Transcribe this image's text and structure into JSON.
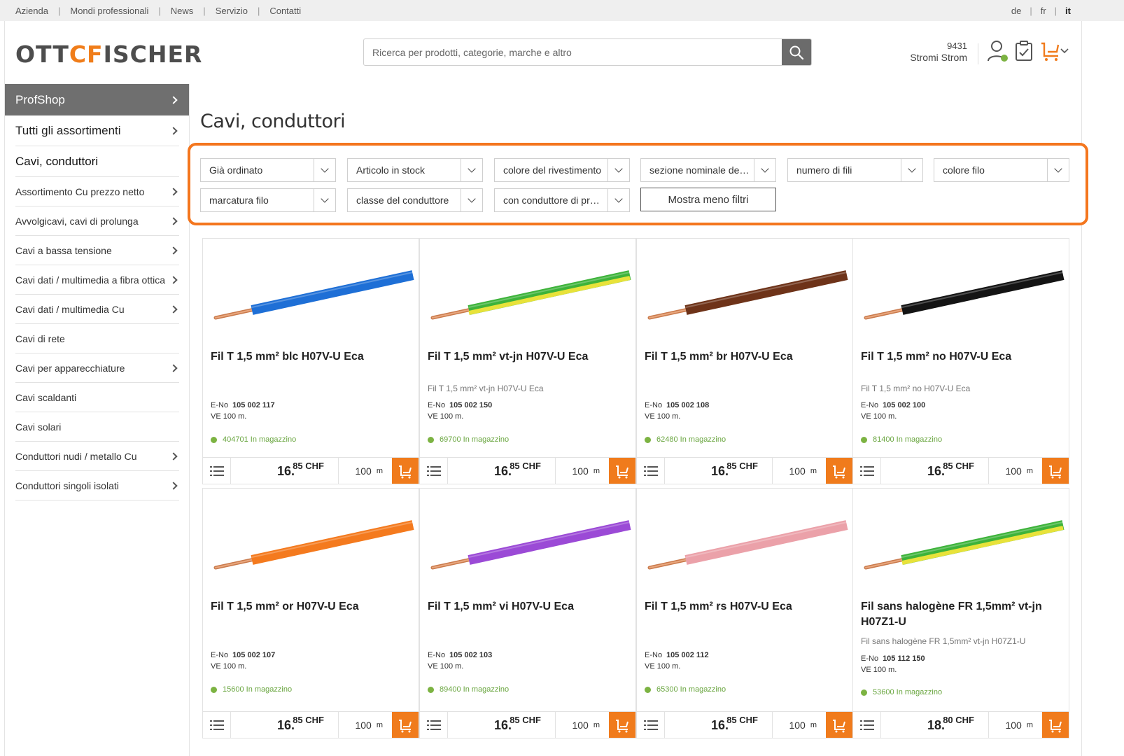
{
  "topnav": {
    "items": [
      "Azienda",
      "Mondi professionali",
      "News",
      "Servizio",
      "Contatti"
    ]
  },
  "languages": {
    "items": [
      "de",
      "fr",
      "it"
    ],
    "active": "it"
  },
  "header": {
    "logo_left": "OTT",
    "logo_mark": "CF",
    "logo_right": "ISCHER",
    "search_placeholder": "Ricerca per prodotti, categorie, marche e altro",
    "account_number": "9431",
    "account_name": "Stromi Strom",
    "icons": [
      "user-icon",
      "order-list-icon",
      "cart-icon",
      "chevron-down-icon"
    ]
  },
  "sidebar": {
    "top": "ProfShop",
    "main": [
      "Tutti gli assortimenti",
      "Cavi, conduttori"
    ],
    "sub": [
      {
        "label": "Assortimento Cu prezzo netto",
        "chevron": true
      },
      {
        "label": "Avvolgicavi, cavi di prolunga",
        "chevron": true
      },
      {
        "label": "Cavi a bassa tensione",
        "chevron": true
      },
      {
        "label": "Cavi dati / multimedia a fibra ottica",
        "chevron": true
      },
      {
        "label": "Cavi dati / multimedia Cu",
        "chevron": true
      },
      {
        "label": "Cavi di rete",
        "chevron": false
      },
      {
        "label": "Cavi per apparecchiature",
        "chevron": true
      },
      {
        "label": "Cavi scaldanti",
        "chevron": false
      },
      {
        "label": "Cavi solari",
        "chevron": false
      },
      {
        "label": "Conduttori nudi / metallo Cu",
        "chevron": true
      },
      {
        "label": "Conduttori singoli isolati",
        "chevron": true
      }
    ]
  },
  "page": {
    "title": "Cavi, conduttori"
  },
  "filters": {
    "selects": [
      "Già ordinato",
      "Articolo in stock",
      "colore del rivestimento",
      "sezione nominale del c...",
      "numero di fili",
      "colore filo",
      "marcatura filo",
      "classe del conduttore",
      "con conduttore di prot..."
    ],
    "toggle_label": "Mostra meno filtri"
  },
  "products": [
    {
      "name": "Fil T 1,5 mm² blc H07V-U Eca",
      "subtitle": "",
      "eno_label": "E-No",
      "eno": "105 002 117",
      "ve": "VE 100 m.",
      "stock": "404701 In magazzino",
      "price_int": "16.",
      "price_dec": "85 CHF",
      "qty": "100",
      "unit": "m",
      "color": "#1e6fd6",
      "color2": ""
    },
    {
      "name": "Fil T 1,5 mm² vt-jn H07V-U Eca",
      "subtitle": "Fil T 1,5 mm² vt-jn H07V-U Eca",
      "eno_label": "E-No",
      "eno": "105 002 150",
      "ve": "VE 100 m.",
      "stock": "69700 In magazzino",
      "price_int": "16.",
      "price_dec": "85 CHF",
      "qty": "100",
      "unit": "m",
      "color": "#3db33a",
      "color2": "#e8e23a"
    },
    {
      "name": "Fil T 1,5 mm² br H07V-U Eca",
      "subtitle": "",
      "eno_label": "E-No",
      "eno": "105 002 108",
      "ve": "VE 100 m.",
      "stock": "62480 In magazzino",
      "price_int": "16.",
      "price_dec": "85 CHF",
      "qty": "100",
      "unit": "m",
      "color": "#6e3319",
      "color2": ""
    },
    {
      "name": "Fil T 1,5 mm² no H07V-U Eca",
      "subtitle": "Fil T 1,5 mm² no H07V-U Eca",
      "eno_label": "E-No",
      "eno": "105 002 100",
      "ve": "VE 100 m.",
      "stock": "81400 In magazzino",
      "price_int": "16.",
      "price_dec": "85 CHF",
      "qty": "100",
      "unit": "m",
      "color": "#141414",
      "color2": ""
    },
    {
      "name": "Fil T 1,5 mm² or H07V-U Eca",
      "subtitle": "",
      "eno_label": "E-No",
      "eno": "105 002 107",
      "ve": "VE 100 m.",
      "stock": "15600 In magazzino",
      "price_int": "16.",
      "price_dec": "85 CHF",
      "qty": "100",
      "unit": "m",
      "color": "#f47a1e",
      "color2": ""
    },
    {
      "name": "Fil T 1,5 mm² vi H07V-U Eca",
      "subtitle": "",
      "eno_label": "E-No",
      "eno": "105 002 103",
      "ve": "VE 100 m.",
      "stock": "89400 In magazzino",
      "price_int": "16.",
      "price_dec": "85 CHF",
      "qty": "100",
      "unit": "m",
      "color": "#9b4ad6",
      "color2": ""
    },
    {
      "name": "Fil T 1,5 mm² rs H07V-U Eca",
      "subtitle": "",
      "eno_label": "E-No",
      "eno": "105 002 112",
      "ve": "VE 100 m.",
      "stock": "65300 In magazzino",
      "price_int": "16.",
      "price_dec": "85 CHF",
      "qty": "100",
      "unit": "m",
      "color": "#eba1a9",
      "color2": ""
    },
    {
      "name": "Fil sans halogène FR 1,5mm² vt-jn H07Z1-U",
      "subtitle": "Fil sans halogène FR 1,5mm² vt-jn H07Z1-U",
      "eno_label": "E-No",
      "eno": "105 112 150",
      "ve": "VE 100 m.",
      "stock": "53600 In magazzino",
      "price_int": "18.",
      "price_dec": "80 CHF",
      "qty": "100",
      "unit": "m",
      "color": "#3db33a",
      "color2": "#e8e23a"
    }
  ],
  "colors": {
    "accent": "#f07b1c",
    "highlight_border": "#f4761e",
    "sidebar_active": "#6f6f6f",
    "stock": "#7cb342"
  }
}
